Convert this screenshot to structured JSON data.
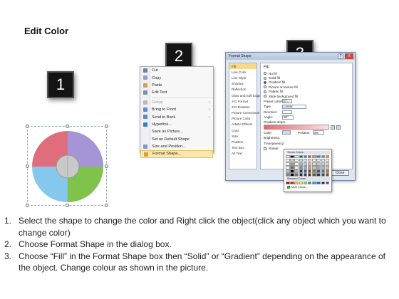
{
  "title": "Edit Color",
  "badges": [
    "1",
    "2",
    "3"
  ],
  "colors": {
    "pie_red": "#e06d7c",
    "pie_purple": "#a594d6",
    "pie_blue": "#86c7ee",
    "pie_green": "#7fc34c",
    "pie_center": "#c9c9c9",
    "highlight": "#fbe7a9"
  },
  "context_menu": {
    "items": [
      {
        "label": "Cut",
        "icon": "scissors-icon",
        "enabled": true
      },
      {
        "label": "Copy",
        "icon": "copy-icon",
        "enabled": true
      },
      {
        "label": "Paste",
        "icon": "paste-icon",
        "enabled": true
      },
      {
        "label": "Edit Text",
        "icon": "edit-text-icon",
        "enabled": true
      },
      {
        "label": "Group",
        "icon": "group-icon",
        "enabled": false,
        "submenu": true
      },
      {
        "label": "Bring to Front",
        "icon": "bring-front-icon",
        "enabled": true,
        "submenu": true
      },
      {
        "label": "Send to Back",
        "icon": "send-back-icon",
        "enabled": true,
        "submenu": true
      },
      {
        "label": "Hyperlink...",
        "icon": "hyperlink-icon",
        "enabled": true
      },
      {
        "label": "Save as Picture...",
        "icon": "",
        "enabled": true
      },
      {
        "label": "Set as Default Shape",
        "icon": "",
        "enabled": true
      },
      {
        "label": "Size and Position...",
        "icon": "size-icon",
        "enabled": true
      },
      {
        "label": "Format Shape...",
        "icon": "format-shape-icon",
        "enabled": true,
        "highlighted": true
      }
    ]
  },
  "dialog": {
    "title": "Format Shape",
    "help": "?",
    "close_x": "X",
    "nav": [
      "Fill",
      "Line Color",
      "Line Style",
      "Shadow",
      "Reflection",
      "Glow and Soft Edges",
      "3-D Format",
      "3-D Rotation",
      "Picture Corrections",
      "Picture Color",
      "Artistic Effects",
      "Crop",
      "Size",
      "Position",
      "Text Box",
      "Alt Text"
    ],
    "panel_title": "Fill",
    "fill_options": [
      {
        "label": "No fill",
        "on": false
      },
      {
        "label": "Solid fill",
        "on": false
      },
      {
        "label": "Gradient fill",
        "on": true
      },
      {
        "label": "Picture or texture fill",
        "on": false
      },
      {
        "label": "Pattern fill",
        "on": false
      },
      {
        "label": "Slide background fill",
        "on": false
      }
    ],
    "preset_label": "Preset colors:",
    "type_label": "Type:",
    "type_value": "Linear",
    "direction_label": "Direction:",
    "angle_label": "Angle:",
    "angle_value": "90°",
    "stops_label": "Gradient stops",
    "color_label": "Color",
    "position_label": "Position:",
    "position_value": "0%",
    "brightness_label": "Brightness:",
    "transparency_label": "Transparency:",
    "rotate_label": "Rotate",
    "close_label": "Close"
  },
  "palette": {
    "theme_label": "Theme Colors",
    "standard_label": "Standard Colors",
    "more_label": "More Colors...",
    "theme_top": [
      "#ffffff",
      "#000000",
      "#eeece1",
      "#1f497d",
      "#4f81bd",
      "#c0504d",
      "#9bbb59",
      "#8064a2",
      "#4bacc6",
      "#f79646"
    ],
    "standard": [
      "#c00000",
      "#ff0000",
      "#ffc000",
      "#ffff00",
      "#92d050",
      "#00b050",
      "#00b0f0",
      "#0070c0",
      "#002060",
      "#7030a0"
    ]
  },
  "steps": [
    {
      "num": "1.",
      "text": "Select the shape to change the color and Right click the object(click any object which you want to change color)"
    },
    {
      "num": "2.",
      "text": "Choose Format Shape in the dialog box."
    },
    {
      "num": "3.",
      "text": "Choose “Fill” in the Format Shape box then “Solid” or “Gradient” depending on the appearance of the object. Change colour as shown in the picture."
    }
  ]
}
